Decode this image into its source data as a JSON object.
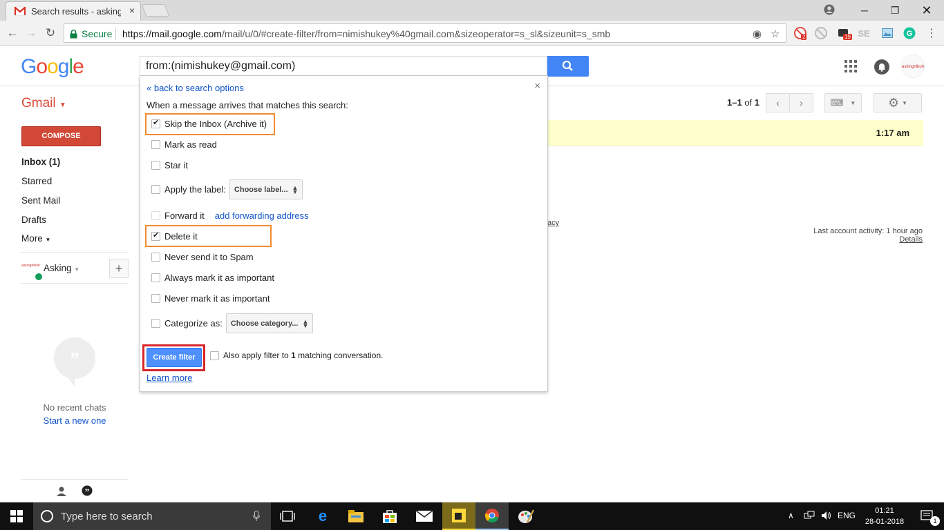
{
  "browser": {
    "tab_title": "Search results - askingm",
    "secure_label": "Secure",
    "url_host": "https://mail.google.com",
    "url_rest": "/mail/u/0/#create-filter/from=nimishukey%40gmail.com&sizeoperator=s_sl&sizeunit=s_smb",
    "ext_badge_1": "2",
    "ext_badge_2": "19",
    "ext_se": "SE"
  },
  "gmail": {
    "logo_text": "Google",
    "search_value": "from:(nimishukey@gmail.com)",
    "app_label": "Gmail",
    "avatar_text": "askingnibuh",
    "pager": {
      "range": "1–1",
      "of": "of",
      "total": "1"
    },
    "compose": "COMPOSE",
    "nav": [
      {
        "label": "Inbox (1)"
      },
      {
        "label": "Starred"
      },
      {
        "label": "Sent Mail"
      },
      {
        "label": "Drafts"
      },
      {
        "label": "More"
      }
    ],
    "hangouts_user": "Asking",
    "hangouts_avatar": "askingnibuh",
    "no_recent_chats": "No recent chats",
    "start_new": "Start a new one",
    "email_time": "1:17 am",
    "privacy_fragment": "acy",
    "last_activity": "Last account activity: 1 hour ago",
    "details": "Details"
  },
  "filter_panel": {
    "back_link": "« back to search options",
    "intro": "When a message arrives that matches this search:",
    "options": {
      "skip_inbox": {
        "label": "Skip the Inbox (Archive it)",
        "checked": true
      },
      "mark_read": {
        "label": "Mark as read",
        "checked": false
      },
      "star_it": {
        "label": "Star it",
        "checked": false
      },
      "apply_label": {
        "label": "Apply the label:",
        "checked": false,
        "select": "Choose label..."
      },
      "forward_it": {
        "label": "Forward it",
        "checked": false,
        "link": "add forwarding address"
      },
      "delete_it": {
        "label": "Delete it",
        "checked": true
      },
      "never_spam": {
        "label": "Never send it to Spam",
        "checked": false
      },
      "always_important": {
        "label": "Always mark it as important",
        "checked": false
      },
      "never_important": {
        "label": "Never mark it as important",
        "checked": false
      },
      "categorize": {
        "label": "Categorize as:",
        "checked": false,
        "select": "Choose category..."
      }
    },
    "create_button": "Create filter",
    "also_apply_pre": "Also apply filter to",
    "also_apply_count": "1",
    "also_apply_post": "matching conversation.",
    "learn_more": "Learn more"
  },
  "taskbar": {
    "search_placeholder": "Type here to search",
    "lang": "ENG",
    "time": "01:21",
    "date": "28-01-2018",
    "notif_count": "1"
  }
}
